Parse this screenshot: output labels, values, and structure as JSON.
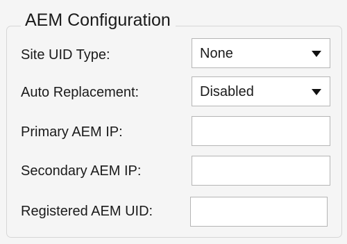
{
  "group": {
    "legend": "AEM Configuration"
  },
  "site_uid_type": {
    "label": "Site UID Type:",
    "value": "None"
  },
  "auto_replacement": {
    "label": "Auto Replacement:",
    "value": "Disabled"
  },
  "primary_aem_ip": {
    "label": "Primary AEM IP:",
    "value": ""
  },
  "secondary_aem_ip": {
    "label": "Secondary AEM IP:",
    "value": ""
  },
  "registered_aem_uid": {
    "label": "Registered AEM UID:",
    "value": ""
  }
}
